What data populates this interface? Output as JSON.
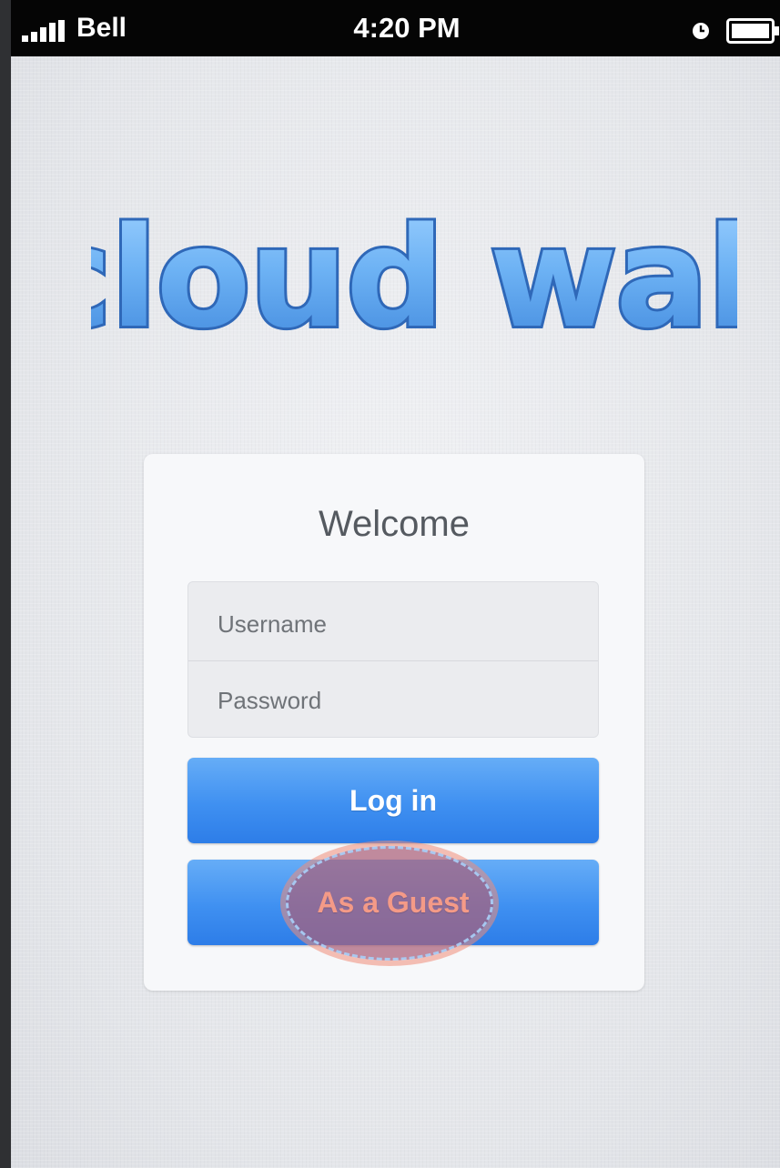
{
  "status_bar": {
    "carrier": "Bell",
    "time": "4:20 PM",
    "signal_icon": "signal-bars-icon",
    "alarm_icon": "alarm-clock-icon",
    "battery_icon": "battery-icon"
  },
  "app": {
    "logo_text": "cloud wall",
    "logo_color": "#5fa3ea"
  },
  "login_card": {
    "title": "Welcome",
    "username_placeholder": "Username",
    "password_placeholder": "Password",
    "login_label": "Log in",
    "guest_label": "As a Guest"
  },
  "colors": {
    "button_top": "#66adf7",
    "button_bottom": "#2d7de8",
    "highlight": "#aa5f78"
  }
}
